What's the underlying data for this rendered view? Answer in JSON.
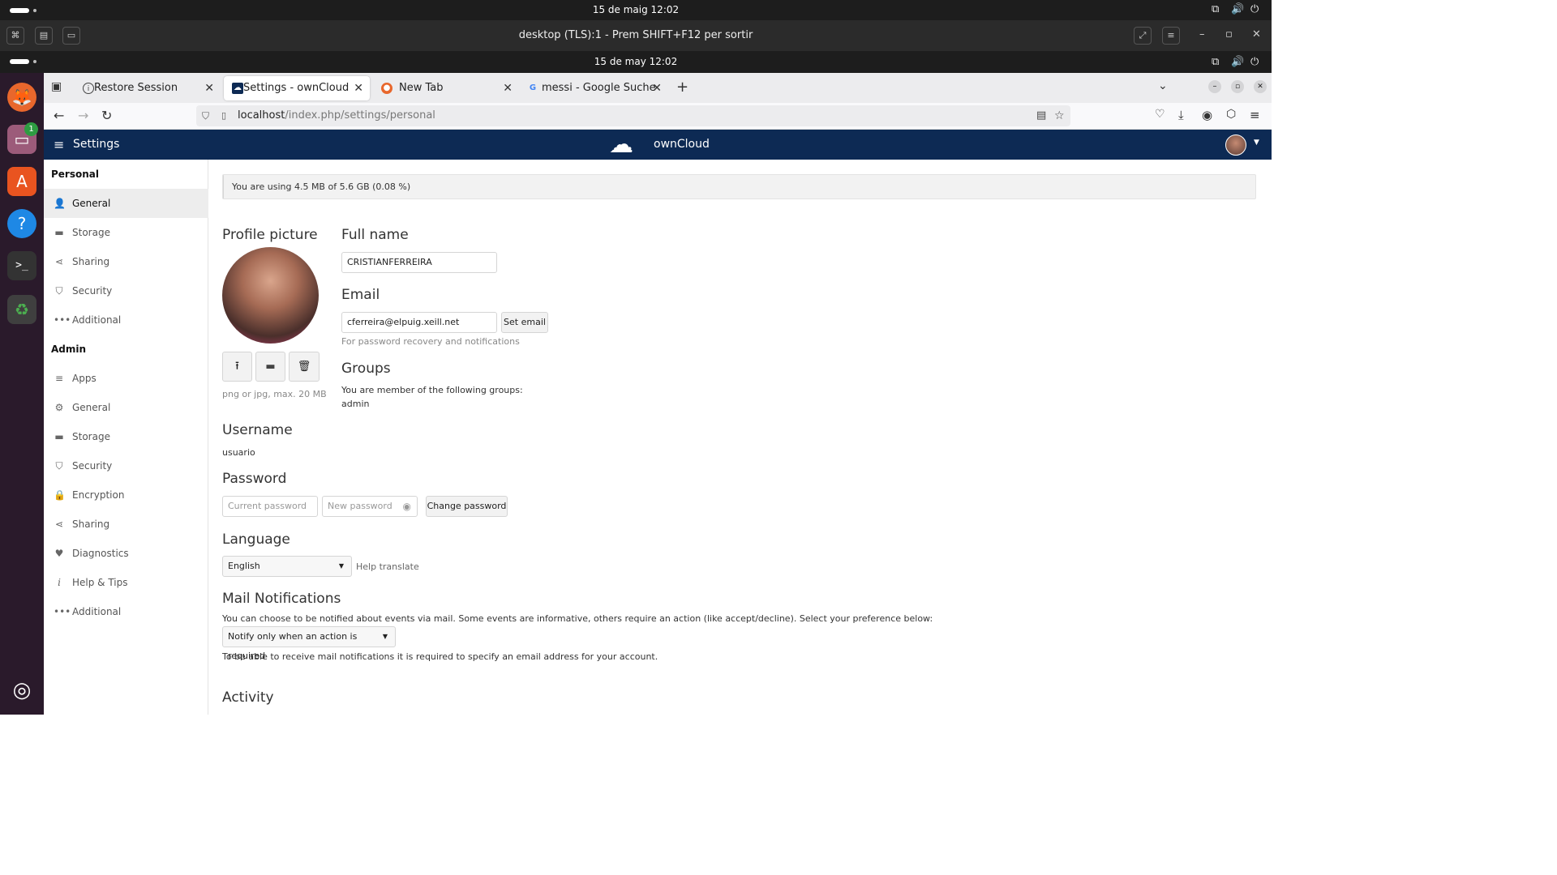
{
  "os": {
    "outer_clock": "15 de maig  12:02",
    "inner_clock": "15 de may  12:02",
    "vnc_title": "desktop (TLS):1 - Prem SHIFT+F12 per sortir",
    "dock_badge": "1"
  },
  "browser": {
    "tabs": [
      {
        "label": "Restore Session",
        "icon": "info-icon"
      },
      {
        "label": "Settings - ownCloud",
        "icon": "owncloud-icon"
      },
      {
        "label": "New Tab",
        "icon": "firefox-icon"
      },
      {
        "label": "messi - Google Suche",
        "icon": "google-icon"
      }
    ],
    "url_host": "localhost",
    "url_path": "/index.php/settings/personal"
  },
  "header": {
    "title": "Settings",
    "brand": "ownCloud"
  },
  "sidebar": {
    "personal_heading": "Personal",
    "personal_items": [
      "General",
      "Storage",
      "Sharing",
      "Security",
      "Additional"
    ],
    "admin_heading": "Admin",
    "admin_items": [
      "Apps",
      "General",
      "Storage",
      "Security",
      "Encryption",
      "Sharing",
      "Diagnostics",
      "Help & Tips",
      "Additional"
    ]
  },
  "quota": {
    "text": "You are using 4.5 MB of 5.6 GB (0.08 %)",
    "fraction_used": 0.0008
  },
  "profile": {
    "heading": "Profile picture",
    "hint": "png or jpg, max. 20 MB"
  },
  "fullname": {
    "heading": "Full name",
    "value": "CRISTIANFERREIRA"
  },
  "email": {
    "heading": "Email",
    "value": "cferreira@elpuig.xeill.net",
    "button": "Set email",
    "hint": "For password recovery and notifications"
  },
  "groups": {
    "heading": "Groups",
    "text": "You are member of the following groups:",
    "list": "admin"
  },
  "username": {
    "heading": "Username",
    "value": "usuario"
  },
  "password": {
    "heading": "Password",
    "current_placeholder": "Current password",
    "new_placeholder": "New password",
    "button": "Change password"
  },
  "language": {
    "heading": "Language",
    "selected": "English",
    "help": "Help translate"
  },
  "mail": {
    "heading": "Mail Notifications",
    "text": "You can choose to be notified about events via mail. Some events are informative, others require an action (like accept/decline). Select your preference below:",
    "selected": "Notify only when an action is required",
    "note": "To be able to receive mail notifications it is required to specify an email address for your account."
  },
  "activity": {
    "heading": "Activity"
  },
  "colors": {
    "header_bg": "#0d2a54",
    "sidebar_selected": "#ededed",
    "dock_bg": "#2a1a2b"
  }
}
